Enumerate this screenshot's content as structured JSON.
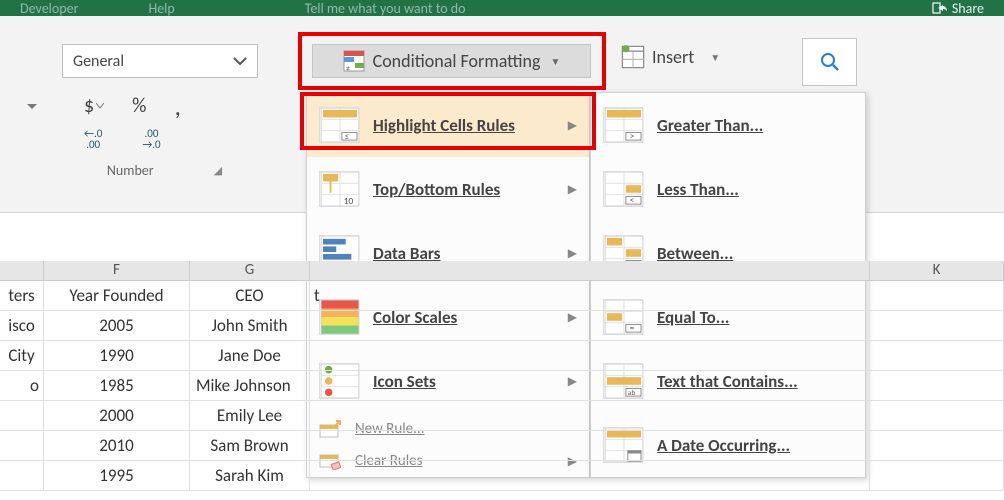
{
  "titlebar": {
    "developer": "Developer",
    "help": "Help",
    "tell": "Tell me what you want to do",
    "share": "Share"
  },
  "number_group": {
    "format": "General",
    "dollar": "$",
    "percent": "%",
    "comma": ",",
    "dec1": "←.0",
    "dec1b": ".00",
    "dec2": ".00",
    "dec2b": "→.0",
    "label": "Number"
  },
  "cf_button": "Conditional Formatting",
  "insert_label": "Insert",
  "menu": {
    "highlight": "Highlight Cells Rules",
    "topbottom": "Top/Bottom Rules",
    "databars": "Data Bars",
    "colorscales": "Color Scales",
    "iconsets": "Icon Sets",
    "newrule": "New Rule...",
    "clearrules": "Clear Rules"
  },
  "submenu": {
    "greater": "Greater Than...",
    "less": "Less Than...",
    "between": "Between...",
    "equal": "Equal To...",
    "text": "Text that Contains...",
    "date": "A Date Occurring..."
  },
  "grid": {
    "col_headers": [
      "F",
      "G",
      "K"
    ],
    "header_row": {
      "e": "ters",
      "f": "Year Founded",
      "g": "CEO",
      "k": "t"
    },
    "rows": [
      {
        "e": "isco",
        "f": "2005",
        "g": "John Smith"
      },
      {
        "e": "City",
        "f": "1990",
        "g": "Jane Doe"
      },
      {
        "e": "o",
        "f": "1985",
        "g": "Mike Johnson"
      },
      {
        "e": "",
        "f": "2000",
        "g": "Emily Lee"
      },
      {
        "e": "",
        "f": "2010",
        "g": "Sam Brown"
      },
      {
        "e": "",
        "f": "1995",
        "g": "Sarah Kim"
      }
    ]
  }
}
